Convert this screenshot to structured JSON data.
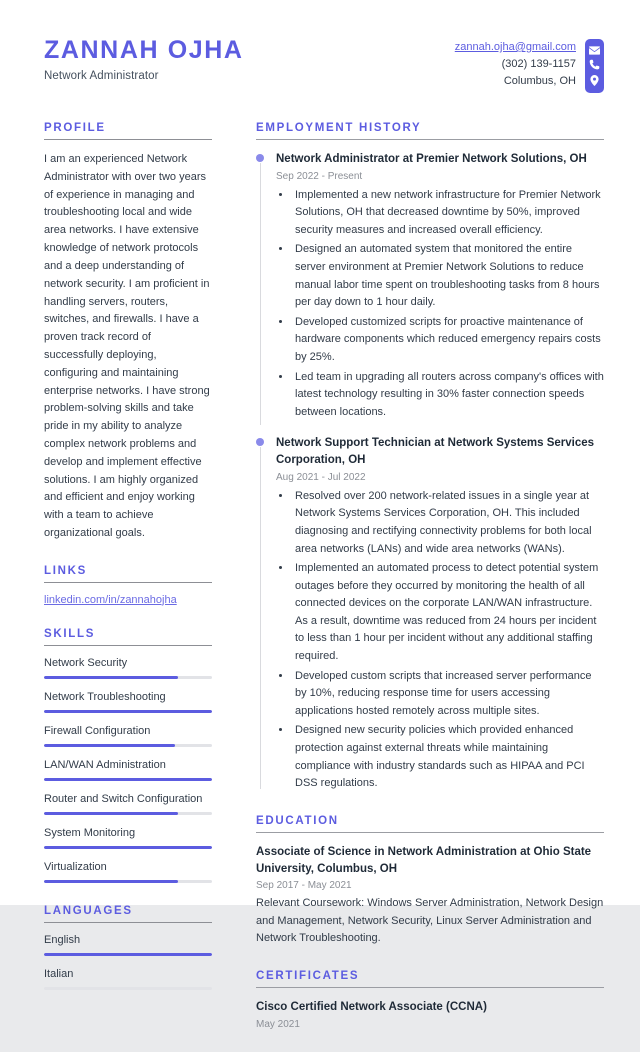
{
  "header": {
    "name": "ZANNAH OJHA",
    "job_title": "Network Administrator",
    "contact": {
      "email": "zannah.ojha@gmail.com",
      "phone": "(302) 139-1157",
      "location": "Columbus, OH",
      "icons": [
        "envelope-icon",
        "phone-icon",
        "location-pin-icon"
      ]
    }
  },
  "theme": {
    "accent": "#5c5ce0",
    "text": "#323c49",
    "muted": "#8b8f96",
    "rule": "#8d8f95",
    "track": "#e2e3e7"
  },
  "sidebar": {
    "profile": {
      "title": "PROFILE",
      "text": "I am an experienced Network Administrator with over two years of experience in managing and troubleshooting local and wide area networks. I have extensive knowledge of network protocols and a deep understanding of network security. I am proficient in handling servers, routers, switches, and firewalls. I have a proven track record of successfully deploying, configuring and maintaining enterprise networks. I have strong problem-solving skills and take pride in my ability to analyze complex network problems and develop and implement effective solutions. I am highly organized and efficient and enjoy working with a team to achieve organizational goals."
    },
    "links": {
      "title": "LINKS",
      "items": [
        {
          "label": "linkedin.com/in/zannahojha"
        }
      ]
    },
    "skills": {
      "title": "SKILLS",
      "items": [
        {
          "label": "Network Security",
          "level": 80
        },
        {
          "label": "Network Troubleshooting",
          "level": 100
        },
        {
          "label": "Firewall Configuration",
          "level": 78
        },
        {
          "label": "LAN/WAN Administration",
          "level": 100
        },
        {
          "label": "Router and Switch Configuration",
          "level": 80
        },
        {
          "label": "System Monitoring",
          "level": 100
        },
        {
          "label": "Virtualization",
          "level": 80
        }
      ]
    },
    "languages": {
      "title": "LANGUAGES",
      "items": [
        {
          "label": "English",
          "level": 100
        },
        {
          "label": "Italian",
          "level": 0
        }
      ]
    }
  },
  "main": {
    "employment": {
      "title": "EMPLOYMENT HISTORY",
      "jobs": [
        {
          "heading": "Network Administrator at Premier Network Solutions, OH",
          "date": "Sep 2022 - Present",
          "bullets": [
            "Implemented a new network infrastructure for Premier Network Solutions, OH that decreased downtime by 50%, improved security measures and increased overall efficiency.",
            "Designed an automated system that monitored the entire server environment at Premier Network Solutions to reduce manual labor time spent on troubleshooting tasks from 8 hours per day down to 1 hour daily.",
            "Developed customized scripts for proactive maintenance of hardware components which reduced emergency repairs costs by 25%.",
            "Led team in upgrading all routers across company's offices with latest technology resulting in 30% faster connection speeds between locations."
          ]
        },
        {
          "heading": "Network Support Technician at Network Systems Services Corporation, OH",
          "date": "Aug 2021 - Jul 2022",
          "bullets": [
            "Resolved over 200 network-related issues in a single year at Network Systems Services Corporation, OH. This included diagnosing and rectifying connectivity problems for both local area networks (LANs) and wide area networks (WANs).",
            "Implemented an automated process to detect potential system outages before they occurred by monitoring the health of all connected devices on the corporate LAN/WAN infrastructure. As a result, downtime was reduced from 24 hours per incident to less than 1 hour per incident without any additional staffing required.",
            "Developed custom scripts that increased server performance by 10%, reducing response time for users accessing applications hosted remotely across multiple sites.",
            "Designed new security policies which provided enhanced protection against external threats while maintaining compliance with industry standards such as HIPAA and PCI DSS regulations."
          ]
        }
      ]
    },
    "education": {
      "title": "EDUCATION",
      "items": [
        {
          "heading": "Associate of Science in Network Administration at Ohio State University, Columbus, OH",
          "date": "Sep 2017 - May 2021",
          "description": "Relevant Coursework: Windows Server Administration, Network Design and Management, Network Security, Linux Server Administration and Network Troubleshooting."
        }
      ]
    },
    "certificates": {
      "title": "CERTIFICATES",
      "items": [
        {
          "heading": "Cisco Certified Network Associate (CCNA)",
          "date": "May 2021"
        }
      ]
    }
  }
}
